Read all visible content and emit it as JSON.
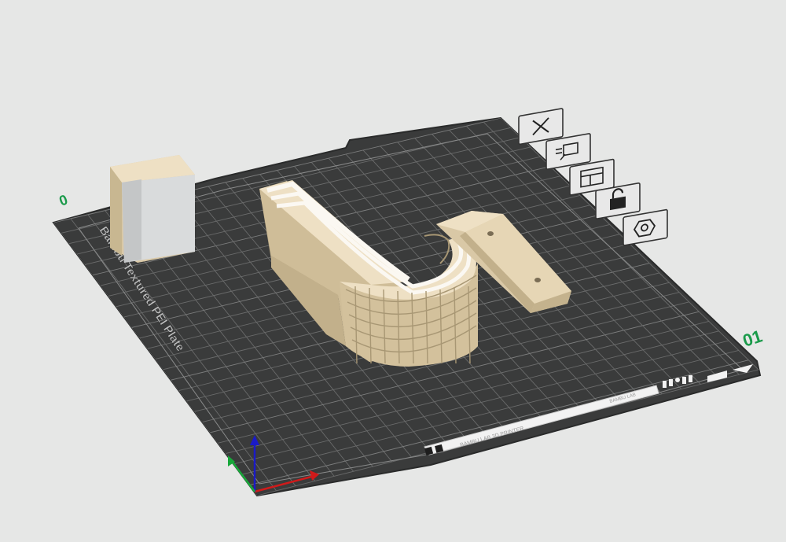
{
  "plate": {
    "name_label": "Bambu Textured PEI Plate",
    "plate_number": "01",
    "corner_marker": "0"
  },
  "strip_text": {
    "left": "BAMBU LAB 3D PRINTER",
    "right": "BAMBU LAB"
  },
  "toolbar": {
    "items": [
      {
        "name": "delete-plate-button",
        "icon": "close-icon"
      },
      {
        "name": "arrange-button",
        "icon": "auto-arrange-icon"
      },
      {
        "name": "plate-settings-button",
        "icon": "layout-icon"
      },
      {
        "name": "lock-plate-button",
        "icon": "unlock-icon"
      },
      {
        "name": "plate-orient-button",
        "icon": "hexagon-nut-icon"
      }
    ]
  },
  "colors": {
    "background": "#e6e7e6",
    "plate": "#3a3b3b",
    "grid": "#6e6f6f",
    "model_light": "#eee0c4",
    "model_mid": "#d9c8a6",
    "model_dark": "#b9a884",
    "selection_gray": "#d9dbdc",
    "plate_number": "#1a9a4a",
    "axis_x": "#d11a1a",
    "axis_y": "#1a1ac8",
    "axis_z": "#18a83a"
  }
}
